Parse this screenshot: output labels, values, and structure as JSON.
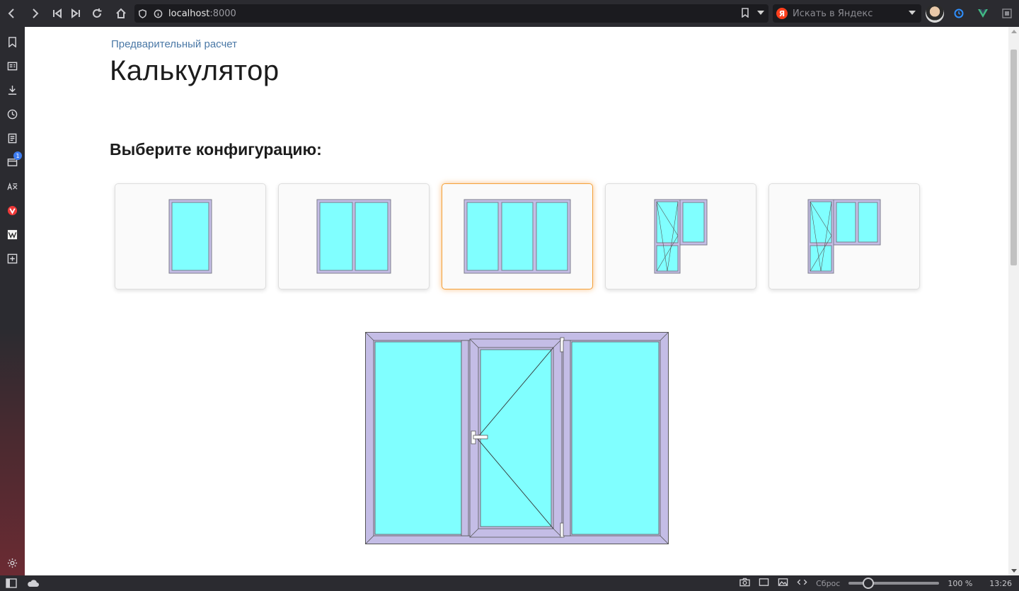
{
  "browser": {
    "url_host": "localhost",
    "url_port": ":8000",
    "search_placeholder": "Искать в Яндекс",
    "search_badge": "Я",
    "sidebar_badge": "1"
  },
  "page": {
    "breadcrumb": "Предварительный расчет",
    "title": "Калькулятор",
    "section_title": "Выберите конфигурацию:"
  },
  "configurations": [
    {
      "name": "single-pane-window",
      "selected": false
    },
    {
      "name": "two-pane-window",
      "selected": false
    },
    {
      "name": "three-pane-window",
      "selected": true
    },
    {
      "name": "balcony-door-with-window",
      "selected": false
    },
    {
      "name": "balcony-door-with-double-window",
      "selected": false
    }
  ],
  "colors": {
    "glass": "#80ffff",
    "frame": "#c4bde6",
    "frame_stroke": "#7d7d8c",
    "selected_accent": "#f4a13a",
    "link": "#4a78a6"
  },
  "statusbar": {
    "reset_label": "Сброс",
    "zoom": "100 %",
    "time": "13:26"
  }
}
